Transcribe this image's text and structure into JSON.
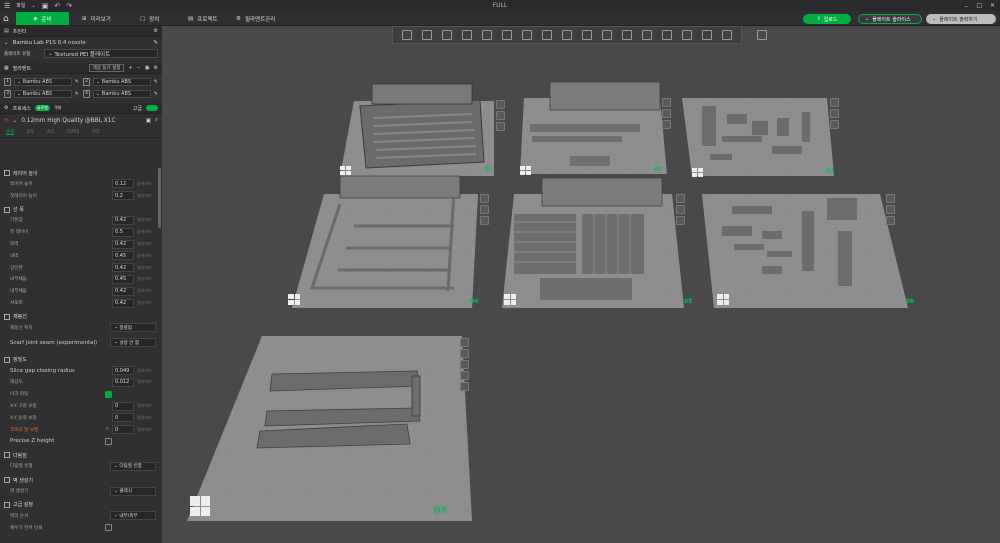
{
  "window": {
    "title": "FULL"
  },
  "quickbar": {
    "file_label": "파일"
  },
  "menu": {
    "tabs": [
      {
        "label": "준비"
      },
      {
        "label": "미리보기"
      },
      {
        "label": "장치"
      },
      {
        "label": "프로젝트"
      },
      {
        "label": "필라멘트관리"
      }
    ],
    "upload_label": "업로드",
    "slice_all_label": "플레이트 슬라이스",
    "print_all_label": "플레이트 출력하기"
  },
  "sidebar": {
    "printer_section": "프린터",
    "printer_name": "Bambu Lab P1S 0.4 nozzle",
    "plate_type_label": "플레이트 유형",
    "plate_type_value": "Textured PEI 플레이트",
    "filament_section": "필라멘트",
    "filament_sync_label": "색상 동기 설정",
    "filaments": [
      {
        "slot": "1",
        "name": "Bambu ABS"
      },
      {
        "slot": "2",
        "name": "Bambu ABS"
      },
      {
        "slot": "3",
        "name": "Bambu ABS"
      },
      {
        "slot": "4",
        "name": "Bambu ABS"
      }
    ],
    "process_section": "프로세스",
    "process_badge1": "글로벌",
    "process_badge2": "객체",
    "advanced_label": "고급",
    "process_profile": "0.12mm High Quality @BBL X1C",
    "subtabs": [
      "품질",
      "강도",
      "속도",
      "지지대",
      "기타"
    ],
    "layer_height_section": "레이어 높이",
    "layer_height": {
      "label": "레이어 높이",
      "value": "0.12",
      "unit": "밀리미터"
    },
    "first_layer_height": {
      "label": "첫레이어 높이",
      "value": "0.2",
      "unit": "밀리미터"
    },
    "line_width_section": "선 폭",
    "line_widths": [
      {
        "label": "기본값",
        "value": "0.42",
        "unit": "밀리미터"
      },
      {
        "label": "첫 레이어",
        "value": "0.5",
        "unit": "밀리미터"
      },
      {
        "label": "외벽",
        "value": "0.42",
        "unit": "밀리미터"
      },
      {
        "label": "내벽",
        "value": "0.45",
        "unit": "밀리미터"
      },
      {
        "label": "상단면",
        "value": "0.42",
        "unit": "밀리미터"
      },
      {
        "label": "내부채움",
        "value": "0.45",
        "unit": "밀리미터"
      },
      {
        "label": "내부채움",
        "value": "0.42",
        "unit": "밀리미터"
      },
      {
        "label": "서포트",
        "value": "0.42",
        "unit": "밀리미터"
      }
    ],
    "seam_section": "재봉선",
    "seam_position": {
      "label": "재봉선 위치",
      "value": "정렬됨"
    },
    "scarf_seam": {
      "label": "Scarf joint seam (experimental)",
      "value": "설정 안 함"
    },
    "precision_section": "정밀도",
    "slice_gap": {
      "label": "Slice gap closing radius",
      "value": "0.049",
      "unit": "밀리미터"
    },
    "resolution": {
      "label": "해상도",
      "value": "0.012",
      "unit": "밀리미터"
    },
    "arc_fitting": {
      "label": "아크 피팅"
    },
    "xy_hole": {
      "label": "X-Y 구멍 보정",
      "value": "0",
      "unit": "밀리미터"
    },
    "xy_contour": {
      "label": "X-Y 윤곽 보정",
      "value": "0",
      "unit": "밀리미터"
    },
    "elephant_foot": {
      "label": "코끼리 발 보정",
      "value": "0",
      "unit": "밀리미터"
    },
    "precise_z": {
      "label": "Precise Z height"
    },
    "ironing_section": "다림질",
    "ironing_type": {
      "label": "다림질 유형",
      "value": "다림질 안함"
    },
    "wall_gen_section": "벽 생성기",
    "wall_generator": {
      "label": "벽 생성기",
      "value": "클래식"
    },
    "advanced_section": "고급 설정",
    "wall_order": {
      "label": "벽의 순서",
      "value": "내부/외부"
    },
    "print_infill_first": {
      "label": "채우기 먼저 인쇄"
    }
  },
  "plates": [
    {
      "num": "01"
    },
    {
      "num": "02"
    },
    {
      "num": "03"
    },
    {
      "num": "04"
    },
    {
      "num": "05"
    },
    {
      "num": "06"
    },
    {
      "num": "07"
    }
  ]
}
